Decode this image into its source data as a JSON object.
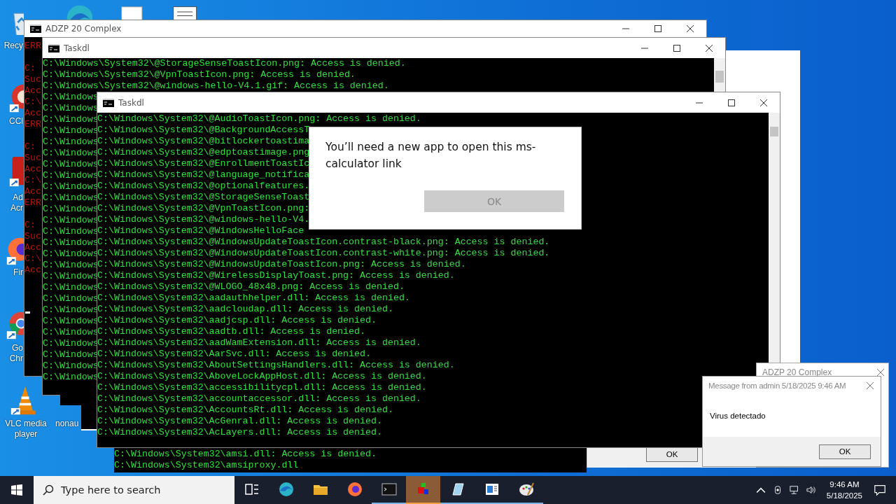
{
  "desktop_icons": [
    {
      "kind": "recycle-bin",
      "label": [
        "Recy"
      ]
    },
    {
      "kind": "edge"
    },
    {
      "kind": "document"
    },
    {
      "kind": "notepad"
    },
    {
      "kind": "ccleaner",
      "label": [
        "CCl"
      ]
    },
    {
      "kind": "adobe",
      "label": [
        "Ad",
        "Acr"
      ]
    },
    {
      "kind": "firefox",
      "label": [
        "Fir"
      ]
    },
    {
      "kind": "chrome",
      "label": [
        "Go",
        "Chr"
      ]
    },
    {
      "kind": "vlc",
      "label": [
        "VLC media",
        "player"
      ]
    },
    {
      "kind": "file",
      "label": [
        "nonau"
      ]
    }
  ],
  "adzp_console": {
    "title": "ADZP 20 Complex",
    "blocks": [
      [
        "ERR"
      ],
      [
        "C:",
        "Suc",
        "Acc",
        "C:\\",
        "Acc",
        "ERR"
      ],
      [
        "C:",
        "Suc",
        "Acc",
        "C:\\",
        "Acc",
        "ERR"
      ],
      [
        "C:",
        "Suc",
        "Acc",
        "C:\\",
        "Acc"
      ]
    ]
  },
  "taskdl_back": {
    "title": "Taskdl",
    "lines": [
      "C:\\Windows\\System32\\@StorageSenseToastIcon.png: Access is denied.",
      "C:\\Windows\\System32\\@VpnToastIcon.png: Access is denied.",
      "C:\\Windows\\System32\\@windows-hello-V4.1.gif: Access is denied.",
      "C:\\Windows",
      "C:\\Windows",
      "C:\\Windows",
      "C:\\Windows",
      "C:\\Windows",
      "C:\\Windows",
      "C:\\Windows",
      "C:\\Windows",
      "C:\\Windows",
      "C:\\Windows",
      "C:\\Windows",
      "C:\\Windows",
      "C:\\Windows",
      "C:\\Windows",
      "C:\\Windows",
      "C:\\Windows",
      "C:\\Windows",
      "C:\\Windows",
      "C:\\Windows",
      "C:\\Windows",
      "C:\\Windows",
      "C:\\Windows",
      "C:\\Windows",
      "C:\\Windows",
      "C:\\Windows",
      "C:\\Windows"
    ]
  },
  "bottom_console": {
    "lines": [
      "C:\\Windows\\System32\\amsi.dll: Access is denied.",
      "C:\\Windows\\System32\\amsiproxy.dll"
    ]
  },
  "back_dialog": {
    "button": "OK"
  },
  "taskdl_front": {
    "title": "Taskdl",
    "lines": [
      "C:\\Windows\\System32\\@AudioToastIcon.png: Access is denied.",
      "C:\\Windows\\System32\\@BackgroundAccessT",
      "C:\\Windows\\System32\\@bitlockertoastima",
      "C:\\Windows\\System32\\@edptoastimage.png",
      "C:\\Windows\\System32\\@EnrollmentToastIc",
      "C:\\Windows\\System32\\@language_notifica",
      "C:\\Windows\\System32\\@optionalfeatures.",
      "C:\\Windows\\System32\\@StorageSenseToast",
      "C:\\Windows\\System32\\@VpnToastIcon.png:",
      "C:\\Windows\\System32\\@windows-hello-V4.",
      "C:\\Windows\\System32\\@WindowsHelloFace",
      "C:\\Windows\\System32\\@WindowsUpdateToastIcon.contrast-black.png: Access is denied.",
      "C:\\Windows\\System32\\@WindowsUpdateToastIcon.contrast-white.png: Access is denied.",
      "C:\\Windows\\System32\\@WindowsUpdateToastIcon.png: Access is denied.",
      "C:\\Windows\\System32\\@WirelessDisplayToast.png: Access is denied.",
      "C:\\Windows\\System32\\@WLOGO_48x48.png: Access is denied.",
      "C:\\Windows\\System32\\aadauthhelper.dll: Access is denied.",
      "C:\\Windows\\System32\\aadcloudap.dll: Access is denied.",
      "C:\\Windows\\System32\\aadjcsp.dll: Access is denied.",
      "C:\\Windows\\System32\\aadtb.dll: Access is denied.",
      "C:\\Windows\\System32\\aadWamExtension.dll: Access is denied.",
      "C:\\Windows\\System32\\AarSvc.dll: Access is denied.",
      "C:\\Windows\\System32\\AboutSettingsHandlers.dll: Access is denied.",
      "C:\\Windows\\System32\\AboveLockAppHost.dll: Access is denied.",
      "C:\\Windows\\System32\\accessibilitycpl.dll: Access is denied.",
      "C:\\Windows\\System32\\accountaccessor.dll: Access is denied.",
      "C:\\Windows\\System32\\AccountsRt.dll: Access is denied.",
      "C:\\Windows\\System32\\AcGenral.dll: Access is denied.",
      "C:\\Windows\\System32\\AcLayers.dll: Access is denied."
    ]
  },
  "app_dialog": {
    "message": "You’ll need a new app to open this ms-calculator link",
    "button": "OK"
  },
  "adzp_popup": {
    "title": "ADZP 20 Complex"
  },
  "message_box": {
    "title": "Message from admin 5/18/2025 9:46 AM",
    "message": "Virus detectado",
    "button": "OK"
  },
  "taskbar": {
    "search_placeholder": "Type here to search",
    "apps": [
      {
        "kind": "task-view",
        "running": false,
        "selected": false
      },
      {
        "kind": "edge",
        "running": false,
        "selected": false
      },
      {
        "kind": "explorer",
        "running": false,
        "selected": false
      },
      {
        "kind": "firefox",
        "running": false,
        "selected": false
      },
      {
        "kind": "terminal",
        "running": true,
        "selected": false
      },
      {
        "kind": "cubes",
        "running": true,
        "selected": true
      },
      {
        "kind": "notepad",
        "running": true,
        "selected": false
      },
      {
        "kind": "window",
        "running": true,
        "selected": false
      },
      {
        "kind": "paint",
        "running": true,
        "selected": false
      }
    ],
    "time": "9:46 AM",
    "date": "5/18/2025"
  }
}
